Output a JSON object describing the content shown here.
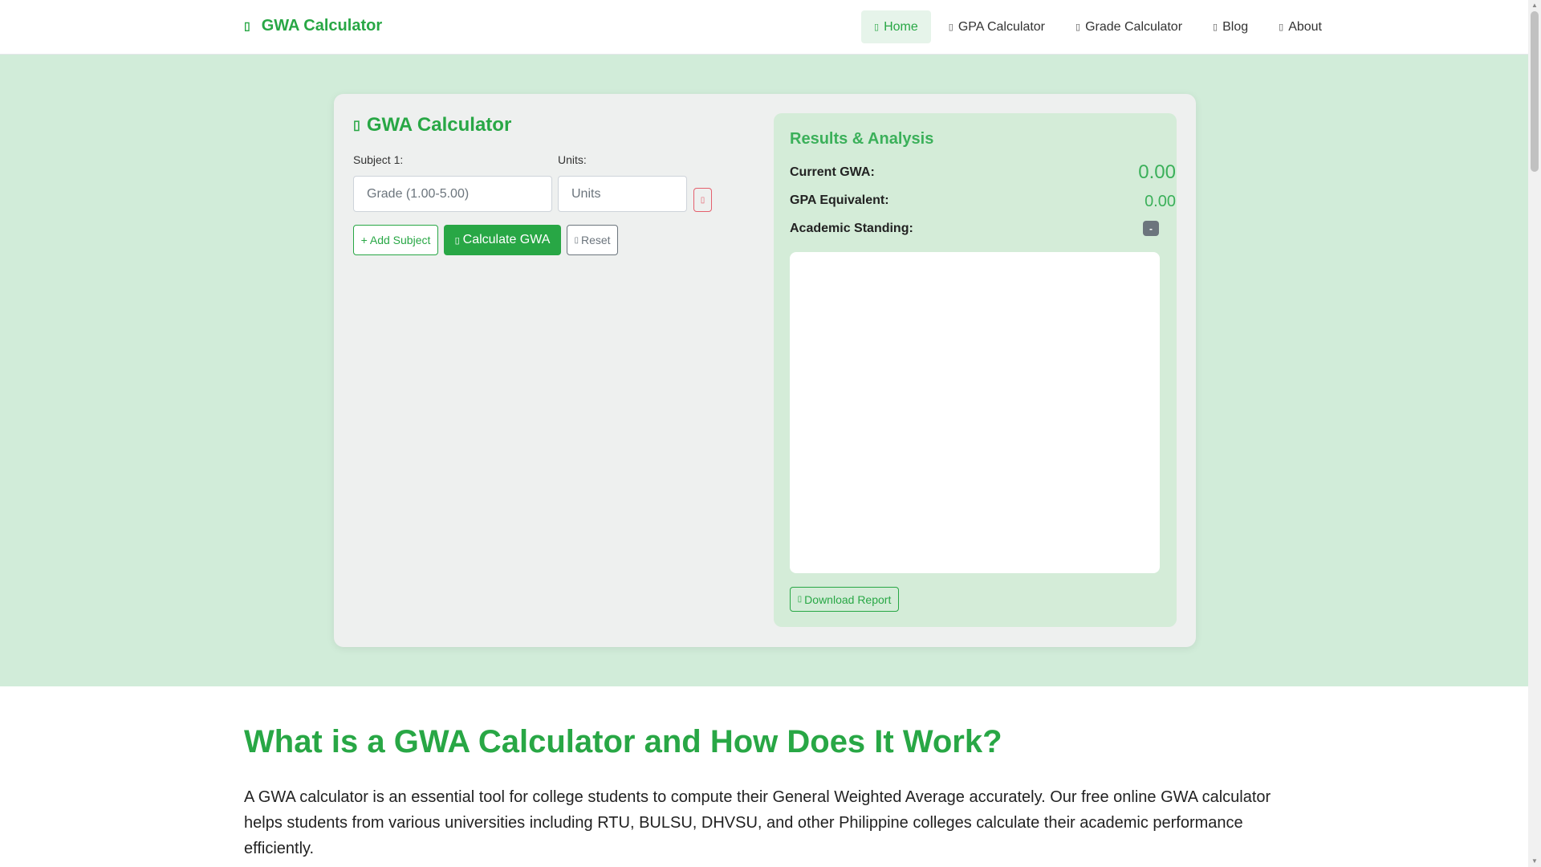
{
  "navbar": {
    "brand": "GWA Calculator",
    "brand_icon": "calculator-icon",
    "items": [
      {
        "label": "Home",
        "icon": "home-icon",
        "active": true
      },
      {
        "label": "GPA Calculator",
        "icon": "chart-icon"
      },
      {
        "label": "Grade Calculator",
        "icon": "percent-icon"
      },
      {
        "label": "Blog",
        "icon": "blog-icon"
      },
      {
        "label": "About",
        "icon": "info-icon"
      }
    ]
  },
  "calculator": {
    "title": "GWA Calculator",
    "subject_label": "Subject 1:",
    "units_label": "Units:",
    "grade_placeholder": "Grade (1.00-5.00)",
    "units_placeholder": "Units",
    "add_label": "+ Add Subject",
    "calculate_label": "Calculate GWA",
    "reset_label": "Reset"
  },
  "results": {
    "title": "Results & Analysis",
    "current_gwa_label": "Current GWA:",
    "current_gwa_value": "0.00",
    "gpa_label": "GPA Equivalent:",
    "gpa_value": "0.00",
    "standing_label": "Academic Standing:",
    "standing_value": "-",
    "download_label": "Download Report"
  },
  "article": {
    "title": "What is a GWA Calculator and How Does It Work?",
    "paragraph": "A GWA calculator is an essential tool for college students to compute their General Weighted Average accurately. Our free online GWA calculator helps students from various universities including RTU, BULSU, DHVSU, and other Philippine colleges calculate their academic performance efficiently."
  },
  "colors": {
    "accent": "#28a745",
    "band": "#d1ecd9",
    "results_bg": "#d4ecd8"
  }
}
